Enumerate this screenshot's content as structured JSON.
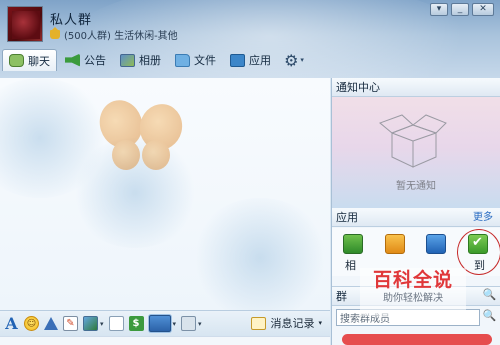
{
  "window": {
    "group_name": "私人群",
    "group_meta": "(500人群) 生活休闲-其他",
    "controls": [
      "▾",
      "_",
      "✕"
    ]
  },
  "tabs": [
    {
      "label": "聊天",
      "icon": "chat-icon",
      "active": true
    },
    {
      "label": "公告",
      "icon": "announcement-icon",
      "active": false
    },
    {
      "label": "相册",
      "icon": "album-icon",
      "active": false
    },
    {
      "label": "文件",
      "icon": "folder-icon",
      "active": false
    },
    {
      "label": "应用",
      "icon": "apps-icon",
      "active": false
    }
  ],
  "toolbar": {
    "history_label": "消息记录",
    "history_caret": "▾"
  },
  "notice_center": {
    "title": "通知中心",
    "empty_text": "暂无通知"
  },
  "apps": {
    "title": "应用",
    "more_label": "更多",
    "items": [
      {
        "label": "相",
        "icon": "album-app-icon"
      },
      {
        "label": "",
        "icon": "file-app-icon"
      },
      {
        "label": "",
        "icon": "chart-app-icon"
      },
      {
        "label": "到",
        "icon": "checkin-app-icon"
      }
    ]
  },
  "members": {
    "title": "群",
    "search_value": "搜索群成员"
  },
  "watermark": {
    "main": "百科全说",
    "sub": "助你轻松解决"
  },
  "colors": {
    "accent_blue": "#2a6cc2",
    "highlight_red": "#c62a2a"
  }
}
